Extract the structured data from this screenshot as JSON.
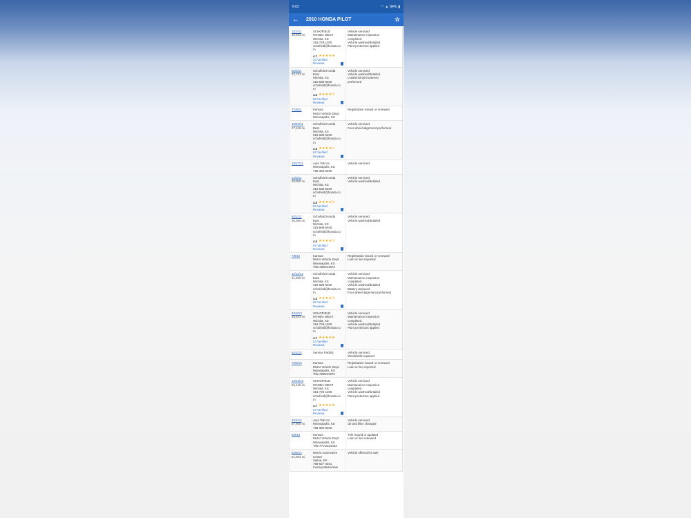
{
  "statusbar": {
    "time": "6:02",
    "battery": "84%"
  },
  "appbar": {
    "title": "2010 HONDA PILOT"
  },
  "records": [
    {
      "date": "1/17/11",
      "miles": "15,834 mi.",
      "source": [
        "SCHOFIELD",
        "HONDA WEST",
        "Wichita, KS",
        "316-729-1300",
        "schofield@honda.co",
        "m"
      ],
      "rating": "4.7",
      "stars": "★★★★★",
      "reviews": [
        "23 Verified",
        "Reviews"
      ],
      "details": [
        "Vehicle serviced",
        "Maintenance inspection",
        "completed",
        "Vehicle washed/detailed",
        "Paint protection applied"
      ]
    },
    {
      "date": "6/20/11",
      "miles": "22,731 mi.",
      "source": [
        "Schofield Honda",
        "East",
        "Wichita, KS",
        "316-688-6400",
        "schofield@honda.co",
        "m"
      ],
      "rating": "4.5",
      "stars": "★★★★½",
      "reviews": [
        "92 Verified",
        "Reviews"
      ],
      "details": [
        "Vehicle serviced",
        "Vehicle washed/detailed",
        "Leather/vinyl treatment",
        "performed"
      ]
    },
    {
      "date": "7/19/11",
      "miles": "",
      "source": [
        "Kansas",
        "Motor Vehicle Dept.",
        "Minneapolis, KS"
      ],
      "details": [
        "Registration issued or renewed"
      ]
    },
    {
      "date": "10/22/11",
      "miles": "27,436 mi.",
      "source": [
        "Schofield Honda",
        "East",
        "Wichita, KS",
        "316-688-6400",
        "schofield@honda.co",
        "m"
      ],
      "rating": "4.5",
      "stars": "★★★★½",
      "reviews": [
        "92 Verified",
        "Reviews"
      ],
      "details": [
        "Vehicle serviced",
        "Four wheel alignment performed"
      ]
    },
    {
      "date": "10/27/11",
      "miles": "",
      "source": [
        "Auto Tek Inc.",
        "Minneapolis, KS",
        "785-392-6400"
      ],
      "details": [
        "Vehicle serviced"
      ]
    },
    {
      "date": "12/3/11",
      "miles": "28,000 mi.",
      "source": [
        "Schofield Honda",
        "East",
        "Wichita, KS",
        "316-688-6400",
        "schofield@honda.co",
        "m"
      ],
      "rating": "4.5",
      "stars": "★★★★½",
      "reviews": [
        "92 Verified",
        "Reviews"
      ],
      "details": [
        "Vehicle serviced",
        "Vehicle washed/detailed"
      ]
    },
    {
      "date": "6/21/12",
      "miles": "36,365 mi.",
      "source": [
        "Schofield Honda",
        "East",
        "Wichita, KS",
        "316-688-6400",
        "schofield@honda.co",
        "m"
      ],
      "rating": "4.5",
      "stars": "★★★★½",
      "reviews": [
        "92 Verified",
        "Reviews"
      ],
      "details": [
        "Vehicle serviced",
        "Vehicle washed/detailed"
      ]
    },
    {
      "date": "7/9/12",
      "miles": "",
      "source": [
        "Kansas",
        "Motor Vehicle Dept.",
        "Minneapolis, KS",
        "Title #ZZ341972"
      ],
      "details": [
        "Registration issued or renewed",
        "Loan or lien reported"
      ]
    },
    {
      "date": "11/12/12",
      "miles": "41,605 mi.",
      "source": [
        "Schofield Honda",
        "East",
        "Wichita, KS",
        "316-688-6400",
        "schofield@honda.co",
        "m"
      ],
      "rating": "4.5",
      "stars": "★★★★½",
      "reviews": [
        "92 Verified",
        "Reviews"
      ],
      "details": [
        "Vehicle serviced",
        "Maintenance inspection",
        "completed",
        "Vehicle washed/detailed",
        "Battery replaced",
        "Four wheel alignment performed"
      ]
    },
    {
      "date": "5/10/13",
      "miles": "48,403 mi.",
      "source": [
        "SCHOFIELD",
        "HONDA WEST",
        "Wichita, KS",
        "316-729-1300",
        "schofield@honda.co",
        "m"
      ],
      "rating": "4.7",
      "stars": "★★★★★",
      "reviews": [
        "23 Verified",
        "Reviews"
      ],
      "details": [
        "Vehicle serviced",
        "Maintenance inspection",
        "completed",
        "Vehicle washed/detailed",
        "Paint protection applied"
      ]
    },
    {
      "date": "6/12/13",
      "miles": "",
      "source": [
        "Service Facility"
      ],
      "details": [
        "Vehicle serviced",
        "Windshield repaired"
      ]
    },
    {
      "date": "7/26/13",
      "miles": "",
      "source": [
        "Kansas",
        "Motor Vehicle Dept.",
        "Minneapolis, KS",
        "Title #ZZ341972"
      ],
      "details": [
        "Registration issued or renewed",
        "Loan or lien reported"
      ]
    },
    {
      "date": "12/13/13",
      "miles": "55,445 mi.",
      "source": [
        "SCHOFIELD",
        "HONDA WEST",
        "Wichita, KS",
        "316-729-1300",
        "schofield@honda.co",
        "m"
      ],
      "rating": "4.7",
      "stars": "★★★★★",
      "reviews": [
        "23 Verified",
        "Reviews"
      ],
      "details": [
        "Vehicle serviced",
        "Maintenance inspection",
        "completed",
        "Vehicle washed/detailed",
        "Paint protection applied"
      ]
    },
    {
      "date": "4/14/14",
      "miles": "57,860 mi.",
      "source": [
        "Auto Tek Inc.",
        "Minneapolis, KS",
        "785-392-6400"
      ],
      "details": [
        "Vehicle serviced",
        "Oil and filter changed"
      ]
    },
    {
      "date": "5/8/14",
      "miles": "",
      "source": [
        "Kansas",
        "Motor Vehicle Dept.",
        "Minneapolis, KS",
        "Title #AA2224453"
      ],
      "details": [
        "Title issued or updated",
        "Loan or lien released"
      ]
    },
    {
      "date": "6/28/14",
      "miles": "61,903 mi.",
      "source": [
        "Morris Automotive",
        "Center",
        "Salina, KS",
        "785-827-4451",
        "moneysalsamotive"
      ],
      "details": [
        "Vehicle offered for sale"
      ]
    }
  ]
}
